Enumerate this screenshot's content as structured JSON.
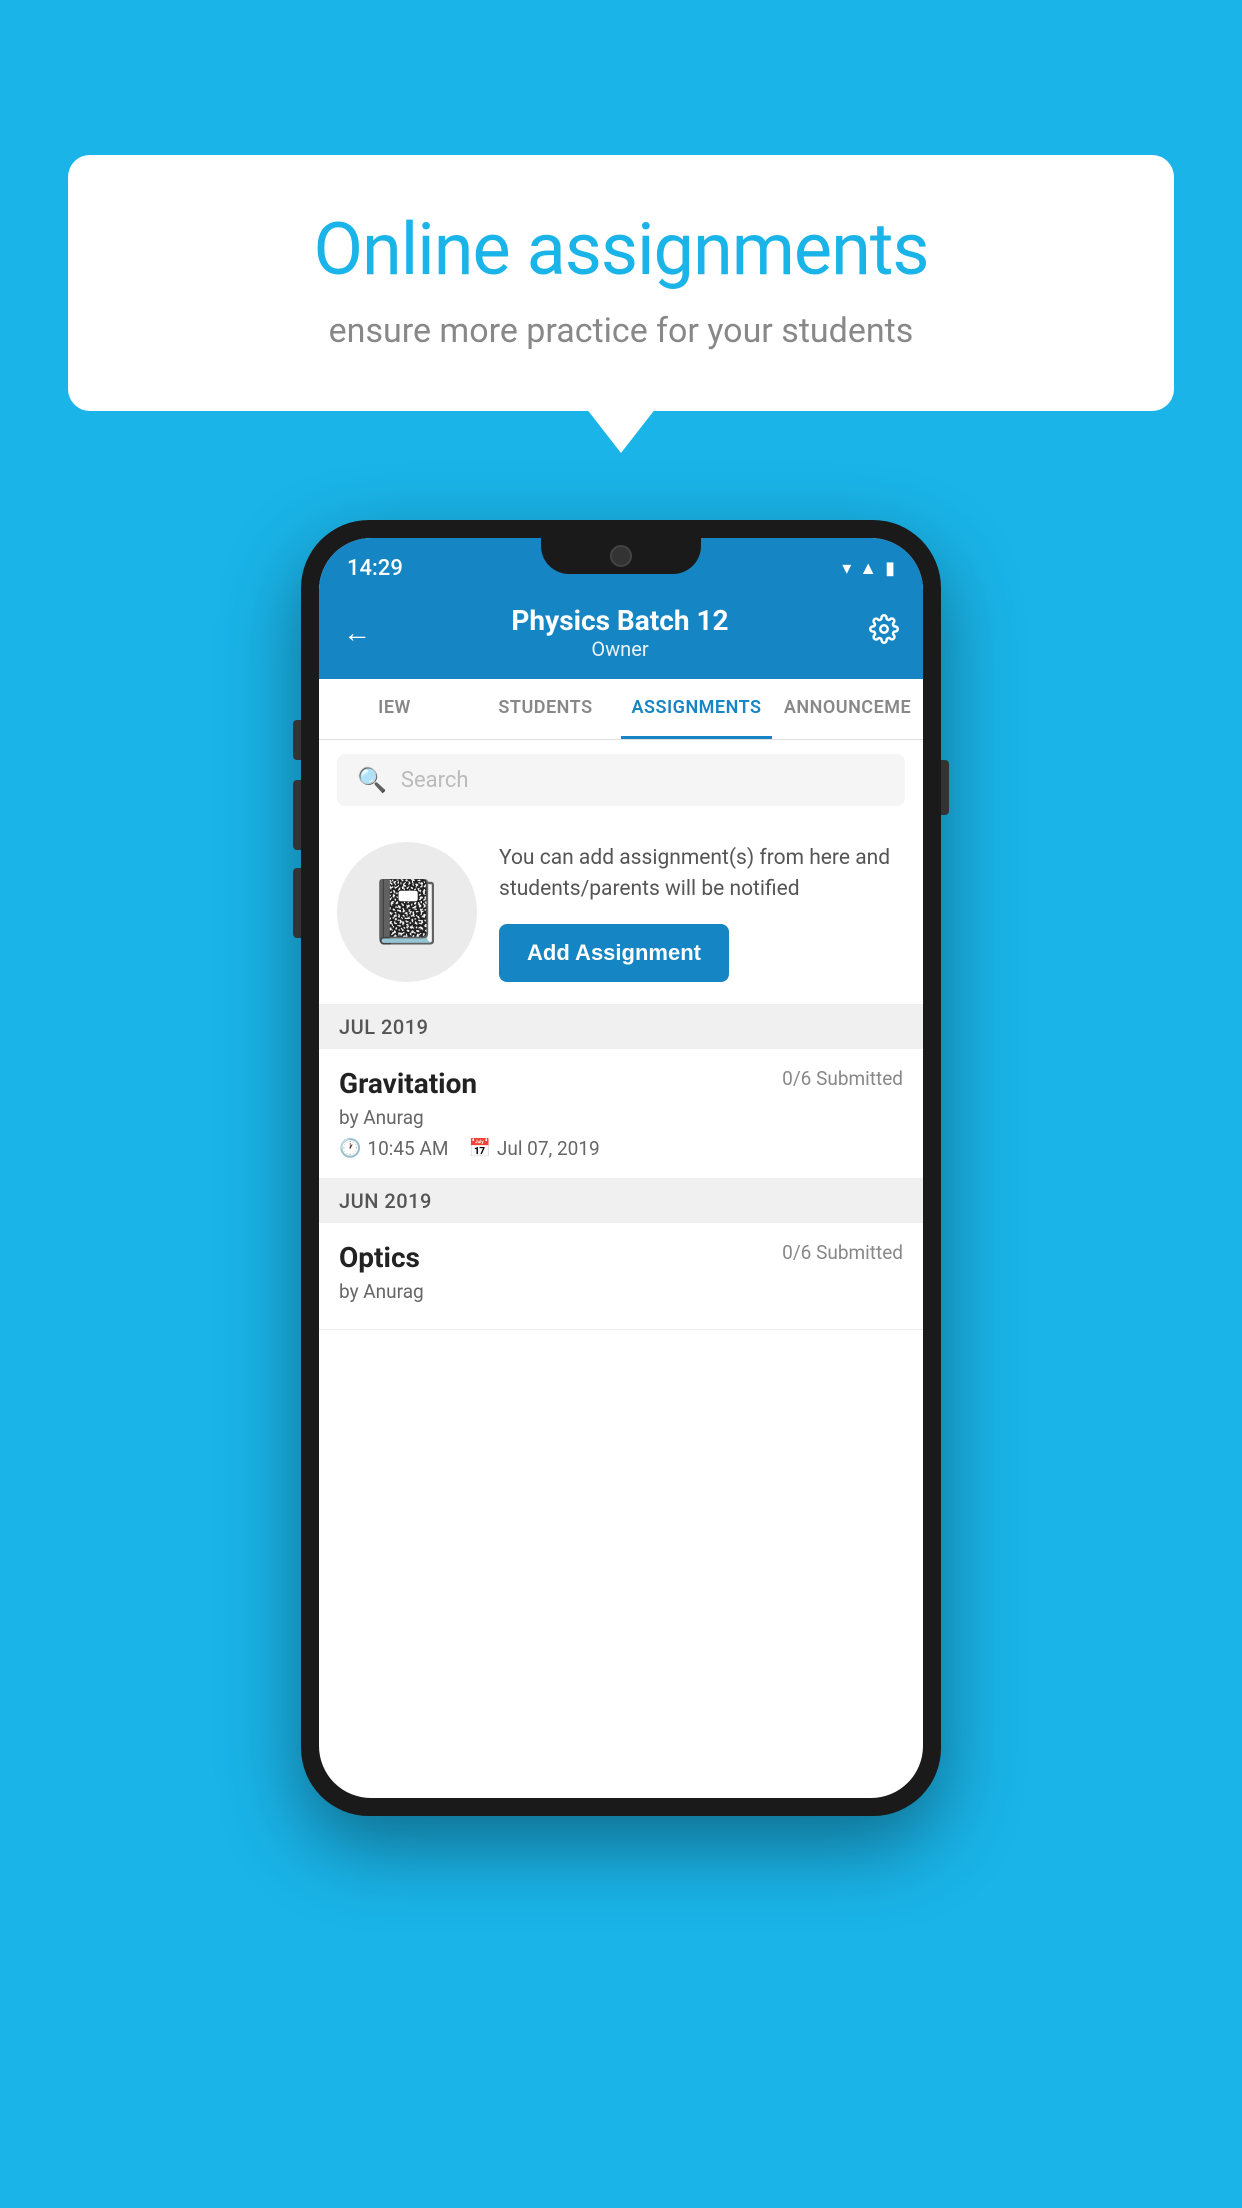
{
  "background": {
    "color": "#1ab4e8"
  },
  "speech_bubble": {
    "title": "Online assignments",
    "subtitle": "ensure more practice for your students"
  },
  "phone": {
    "status_bar": {
      "time": "14:29",
      "icons": [
        "wifi",
        "signal",
        "battery"
      ]
    },
    "header": {
      "title": "Physics Batch 12",
      "subtitle": "Owner",
      "back_label": "←",
      "settings_label": "⚙"
    },
    "tabs": [
      {
        "label": "IEW",
        "active": false
      },
      {
        "label": "STUDENTS",
        "active": false
      },
      {
        "label": "ASSIGNMENTS",
        "active": true
      },
      {
        "label": "ANNOUNCEME",
        "active": false
      }
    ],
    "search": {
      "placeholder": "Search"
    },
    "promo": {
      "description": "You can add assignment(s) from here and students/parents will be notified",
      "button_label": "Add Assignment"
    },
    "assignments": [
      {
        "month_header": "JUL 2019",
        "name": "Gravitation",
        "submitted": "0/6 Submitted",
        "author": "by Anurag",
        "time": "10:45 AM",
        "date": "Jul 07, 2019"
      },
      {
        "month_header": "JUN 2019",
        "name": "Optics",
        "submitted": "0/6 Submitted",
        "author": "by Anurag",
        "time": "",
        "date": ""
      }
    ]
  }
}
